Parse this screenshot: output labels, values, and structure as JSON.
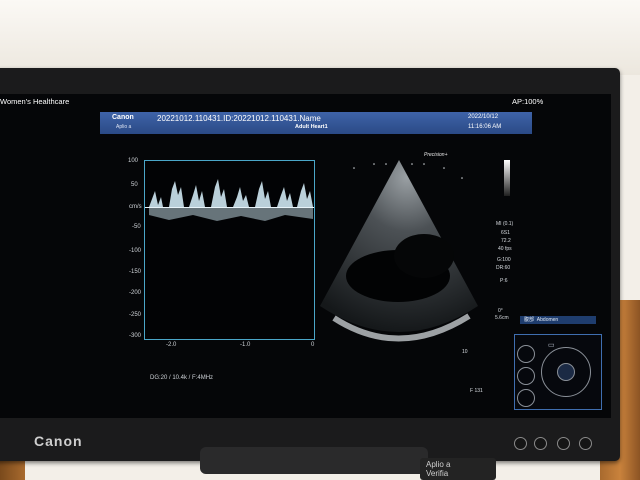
{
  "header": {
    "brand": "Women's Healthcare",
    "ap_indicator": "AP:100%",
    "manufacturer": "Canon",
    "system_model": "Aplio a",
    "patient_line": "20221012.110431.ID:20221012.110431.Name",
    "protocol": "Adult Heart1",
    "date": "2022/10/12",
    "time": "11:16:06 AM"
  },
  "doppler": {
    "y_tick_labels": [
      "100",
      "50",
      "cm/s",
      "-50",
      "-100",
      "-150",
      "-200",
      "-250",
      "-300"
    ],
    "x_tick_labels": [
      "-2.0",
      "-1.0",
      "0"
    ],
    "params": "DG:20 / 10.4k / F:4MHz"
  },
  "image": {
    "preset": "Precision+",
    "depth_marker": "10",
    "params": [
      "MI (0.1)",
      "6S1",
      "72.2",
      "40 fps",
      "G:100",
      "DR:60",
      "P:6",
      "0°",
      "5.6cm"
    ],
    "depth_label_bottom": "F 131"
  },
  "panel": {
    "body_marker": "Abdomen",
    "body_marker_jp": "腹部"
  },
  "bezel": {
    "logo": "Canon",
    "sticker_line1": "Aplio a",
    "sticker_line2": "Verifia"
  },
  "colors": {
    "title_bar": "#3e63a8",
    "doppler_border": "#4aa6c8",
    "panel_border": "#3f6eb0"
  }
}
